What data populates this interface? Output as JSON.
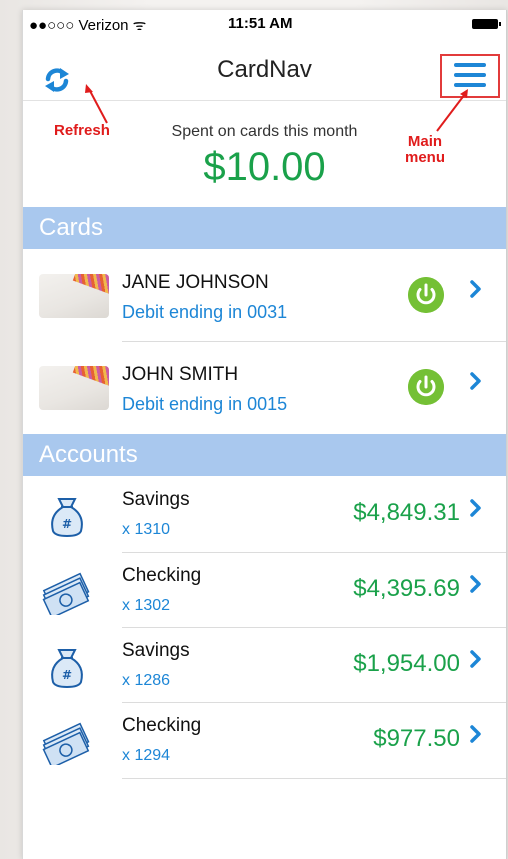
{
  "status_bar": {
    "carrier": "●●○○○ Verizon ᯤ",
    "time": "11:51 AM"
  },
  "header": {
    "title": "CardNav"
  },
  "summary": {
    "label": "Spent on cards this month",
    "amount": "$10.00"
  },
  "annotations": {
    "refresh": "Refresh",
    "main_menu": "Main\nmenu"
  },
  "sections": {
    "cards": "Cards",
    "accounts": "Accounts"
  },
  "cards": [
    {
      "name": "JANE JOHNSON",
      "detail": "Debit ending in 0031"
    },
    {
      "name": "JOHN SMITH",
      "detail": "Debit ending in 0015"
    }
  ],
  "accounts": [
    {
      "name": "Savings",
      "number": "x 1310",
      "balance": "$4,849.31",
      "icon": "money-bag-icon"
    },
    {
      "name": "Checking",
      "number": "x 1302",
      "balance": "$4,395.69",
      "icon": "cash-stack-icon"
    },
    {
      "name": "Savings",
      "number": "x 1286",
      "balance": "$1,954.00",
      "icon": "money-bag-icon"
    },
    {
      "name": "Checking",
      "number": "x 1294",
      "balance": "$977.50",
      "icon": "cash-stack-icon"
    }
  ],
  "colors": {
    "accent_blue": "#1d86d6",
    "money_green": "#1aa14a",
    "power_green": "#74c035",
    "section_bg": "#a9c8ee",
    "annotation_red": "#e01c1c"
  }
}
